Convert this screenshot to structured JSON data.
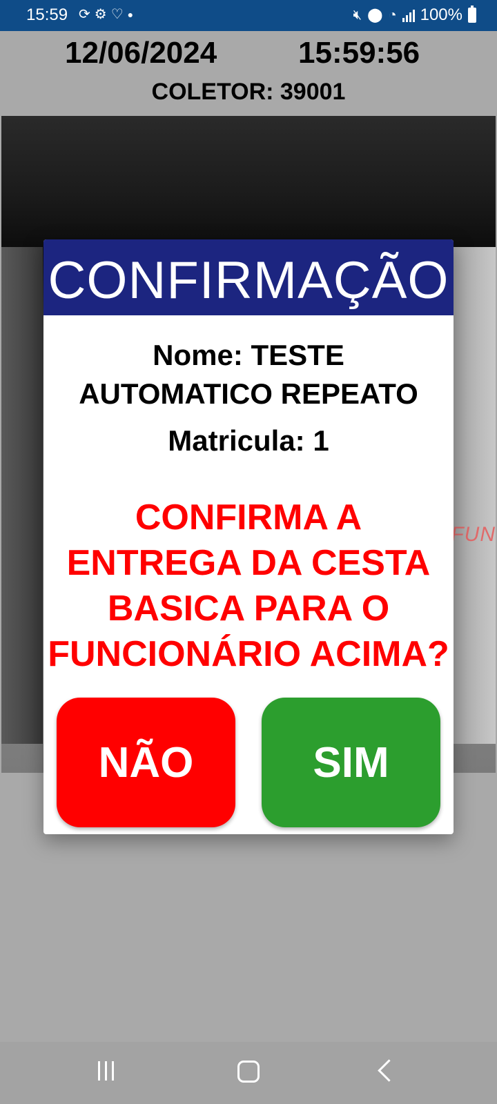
{
  "status_bar": {
    "time": "15:59",
    "battery": "100%",
    "icons": [
      "sync-icon",
      "settings-icon",
      "heart-icon",
      "dot-icon",
      "mute-icon",
      "location-icon",
      "wifi-icon",
      "signal-icon",
      "battery-icon"
    ]
  },
  "header": {
    "date": "12/06/2024",
    "time": "15:59:56",
    "coletor": "COLETOR: 39001"
  },
  "camera": {
    "overlay_text": "FUN"
  },
  "dialog": {
    "title": "CONFIRMAÇÃO",
    "name_line1": "Nome: TESTE",
    "name_line2": "AUTOMATICO REPEATO",
    "matricula": "Matricula: 1",
    "question_line1": "CONFIRMA A",
    "question_line2": "ENTREGA DA CESTA",
    "question_line3": "BASICA PARA O",
    "question_line4": "FUNCIONÁRIO ACIMA?",
    "no_label": "NÃO",
    "yes_label": "SIM",
    "colors": {
      "title_bg": "#1c2580",
      "question": "#ff0000",
      "no_button": "#ff0000",
      "yes_button": "#2c9e2e"
    }
  },
  "nav_bar": {
    "icons": [
      "recent-apps-icon",
      "home-icon",
      "back-icon"
    ]
  }
}
